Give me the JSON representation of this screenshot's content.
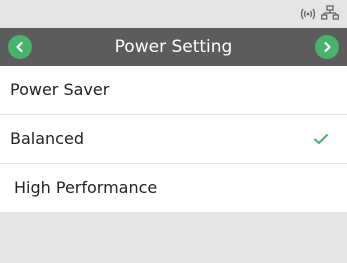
{
  "header": {
    "title": "Power Setting"
  },
  "status_icons": [
    "wireless-signal-icon",
    "network-icon"
  ],
  "options": [
    {
      "label": "Power Saver",
      "selected": false
    },
    {
      "label": "Balanced",
      "selected": true
    },
    {
      "label": "High Performance",
      "selected": false
    }
  ],
  "colors": {
    "accent": "#47b36b",
    "title_bar": "#5c5c5c",
    "status_bar": "#e5e5e5"
  }
}
